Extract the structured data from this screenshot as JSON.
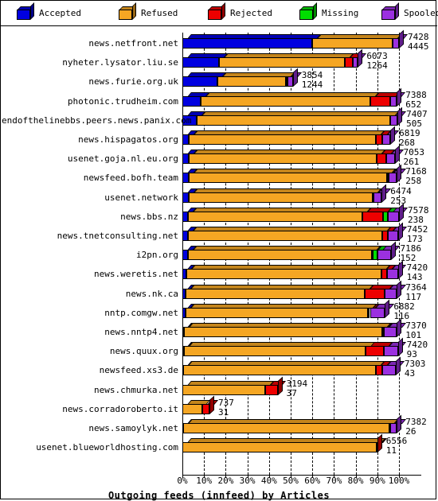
{
  "legend": {
    "items": [
      {
        "label": "Accepted",
        "color": "#0000e0",
        "icon": "cube-icon"
      },
      {
        "label": "Refused",
        "color": "#f5a623",
        "icon": "cube-icon"
      },
      {
        "label": "Rejected",
        "color": "#ee0000",
        "icon": "cube-icon"
      },
      {
        "label": "Missing",
        "color": "#00dd00",
        "icon": "cube-icon"
      },
      {
        "label": "Spooled",
        "color": "#9b30e0",
        "icon": "cube-icon"
      }
    ]
  },
  "chart_data": {
    "type": "bar",
    "orientation": "horizontal",
    "stacked": true,
    "percent": true,
    "title": "Outgoing feeds (innfeed) by Articles",
    "xlabel": "",
    "ylabel": "",
    "xlim": [
      0,
      100
    ],
    "xticks": [
      "0%",
      "10%",
      "20%",
      "30%",
      "40%",
      "50%",
      "60%",
      "70%",
      "80%",
      "90%",
      "100%"
    ],
    "grid": true,
    "legend_position": "top",
    "series": [
      {
        "name": "Accepted",
        "color": "#0000e0"
      },
      {
        "name": "Refused",
        "color": "#f5a623"
      },
      {
        "name": "Rejected",
        "color": "#ee0000"
      },
      {
        "name": "Missing",
        "color": "#00dd00"
      },
      {
        "name": "Spooled",
        "color": "#9b30e0"
      }
    ],
    "categories": [
      "news.netfront.net",
      "nyheter.lysator.liu.se",
      "news.furie.org.uk",
      "photonic.trudheim.com",
      "endofthelinebbs.peers.news.panix.com",
      "news.hispagatos.org",
      "usenet.goja.nl.eu.org",
      "newsfeed.bofh.team",
      "usenet.network",
      "news.bbs.nz",
      "news.tnetconsulting.net",
      "i2pn.org",
      "news.weretis.net",
      "news.nk.ca",
      "nntp.comgw.net",
      "news.nntp4.net",
      "news.quux.org",
      "newsfeed.xs3.de",
      "news.chmurka.net",
      "news.corradoroberto.it",
      "news.samoylyk.net",
      "usenet.blueworldhosting.com"
    ],
    "rows": [
      {
        "category": "news.netfront.net",
        "total": 7428,
        "label2": 4445,
        "bar_pct": 100.0,
        "segments": [
          60.0,
          37.0,
          0.0,
          0.0,
          3.0
        ]
      },
      {
        "category": "nyheter.lysator.liu.se",
        "total": 6073,
        "label2": 1264,
        "bar_pct": 81.0,
        "segments": [
          20.8,
          71.7,
          4.6,
          0.0,
          2.9
        ]
      },
      {
        "category": "news.furie.org.uk",
        "total": 3854,
        "label2": 1244,
        "bar_pct": 51.0,
        "segments": [
          31.5,
          62.0,
          1.6,
          0.0,
          4.9
        ]
      },
      {
        "category": "photonic.trudheim.com",
        "total": 7388,
        "label2": 652,
        "bar_pct": 99.0,
        "segments": [
          8.5,
          79.0,
          9.5,
          0.0,
          3.0
        ]
      },
      {
        "category": "endofthelinebbs.peers.news.panix.com",
        "total": 7407,
        "label2": 505,
        "bar_pct": 99.3,
        "segments": [
          6.5,
          90.0,
          0.2,
          0.0,
          3.3
        ]
      },
      {
        "category": "news.hispagatos.org",
        "total": 6819,
        "label2": 268,
        "bar_pct": 96.0,
        "segments": [
          3.0,
          90.0,
          3.2,
          0.0,
          3.8
        ]
      },
      {
        "category": "usenet.goja.nl.eu.org",
        "total": 7053,
        "label2": 261,
        "bar_pct": 98.0,
        "segments": [
          3.0,
          88.5,
          4.5,
          0.0,
          4.0
        ]
      },
      {
        "category": "newsfeed.bofh.team",
        "total": 7168,
        "label2": 258,
        "bar_pct": 99.0,
        "segments": [
          3.0,
          92.5,
          0.5,
          0.0,
          4.0
        ]
      },
      {
        "category": "usenet.network",
        "total": 6474,
        "label2": 253,
        "bar_pct": 92.0,
        "segments": [
          3.0,
          92.5,
          0.3,
          0.0,
          4.2
        ]
      },
      {
        "category": "news.bbs.nz",
        "total": 7578,
        "label2": 238,
        "bar_pct": 100.0,
        "segments": [
          2.6,
          80.5,
          9.5,
          2.4,
          5.0
        ]
      },
      {
        "category": "news.tnetconsulting.net",
        "total": 7452,
        "label2": 173,
        "bar_pct": 99.6,
        "segments": [
          2.5,
          90.0,
          2.6,
          0.0,
          4.9
        ]
      },
      {
        "category": "i2pn.org",
        "total": 7186,
        "label2": 152,
        "bar_pct": 96.5,
        "segments": [
          2.6,
          88.0,
          0.3,
          2.6,
          6.5
        ]
      },
      {
        "category": "news.weretis.net",
        "total": 7420,
        "label2": 143,
        "bar_pct": 99.5,
        "segments": [
          2.0,
          90.5,
          2.6,
          0.0,
          4.9
        ]
      },
      {
        "category": "news.nk.ca",
        "total": 7364,
        "label2": 117,
        "bar_pct": 99.0,
        "segments": [
          1.4,
          83.5,
          9.3,
          0.0,
          5.8
        ]
      },
      {
        "category": "nntp.comgw.net",
        "total": 6882,
        "label2": 116,
        "bar_pct": 93.5,
        "segments": [
          1.6,
          90.0,
          1.0,
          0.0,
          7.4
        ]
      },
      {
        "category": "news.nntp4.net",
        "total": 7370,
        "label2": 101,
        "bar_pct": 99.0,
        "segments": [
          0.6,
          92.5,
          0.7,
          0.0,
          6.2
        ]
      },
      {
        "category": "news.quux.org",
        "total": 7420,
        "label2": 93,
        "bar_pct": 99.5,
        "segments": [
          0.6,
          84.5,
          8.5,
          0.0,
          6.4
        ]
      },
      {
        "category": "newsfeed.xs3.de",
        "total": 7303,
        "label2": 43,
        "bar_pct": 98.5,
        "segments": [
          0.3,
          90.5,
          3.0,
          0.0,
          6.2
        ]
      },
      {
        "category": "news.chmurka.net",
        "total": 3194,
        "label2": 37,
        "bar_pct": 44.0,
        "segments": [
          0.3,
          87.0,
          12.7,
          0.0,
          0.0
        ]
      },
      {
        "category": "news.corradoroberto.it",
        "total": 737,
        "label2": 31,
        "bar_pct": 12.5,
        "segments": [
          0.5,
          72.0,
          27.5,
          0.0,
          0.0
        ]
      },
      {
        "category": "news.samoylyk.net",
        "total": 7382,
        "label2": 26,
        "bar_pct": 99.0,
        "segments": [
          0.3,
          96.2,
          0.3,
          0.0,
          3.2
        ]
      },
      {
        "category": "usenet.blueworldhosting.com",
        "total": 6556,
        "label2": 11,
        "bar_pct": 90.0,
        "segments": [
          0.2,
          99.6,
          0.2,
          0.0,
          0.0
        ]
      }
    ]
  }
}
